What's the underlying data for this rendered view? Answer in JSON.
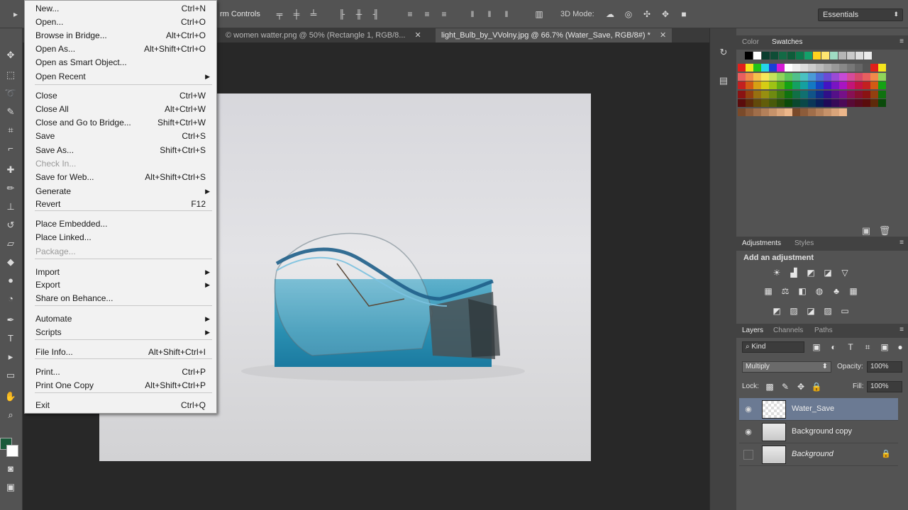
{
  "options_bar": {
    "transform_controls_label": "rm Controls",
    "mode_3d_label": "3D Mode:",
    "workspace": "Essentials"
  },
  "tabs": [
    {
      "label": "© women watter.png @ 50% (Rectangle 1, RGB/8...",
      "active": false
    },
    {
      "label": "light_Bulb_by_VVolny.jpg @ 66.7% (Water_Save, RGB/8#) *",
      "active": true
    }
  ],
  "file_menu": {
    "items": [
      {
        "label": "New...",
        "shortcut": "Ctrl+N"
      },
      {
        "label": "Open...",
        "shortcut": "Ctrl+O"
      },
      {
        "label": "Browse in Bridge...",
        "shortcut": "Alt+Ctrl+O"
      },
      {
        "label": "Open As...",
        "shortcut": "Alt+Shift+Ctrl+O"
      },
      {
        "label": "Open as Smart Object...",
        "shortcut": ""
      },
      {
        "label": "Open Recent",
        "shortcut": "",
        "submenu": true
      },
      {
        "label": "Close",
        "shortcut": "Ctrl+W"
      },
      {
        "label": "Close All",
        "shortcut": "Alt+Ctrl+W"
      },
      {
        "label": "Close and Go to Bridge...",
        "shortcut": "Shift+Ctrl+W"
      },
      {
        "label": "Save",
        "shortcut": "Ctrl+S"
      },
      {
        "label": "Save As...",
        "shortcut": "Shift+Ctrl+S"
      },
      {
        "label": "Check In...",
        "shortcut": "",
        "disabled": true
      },
      {
        "label": "Save for Web...",
        "shortcut": "Alt+Shift+Ctrl+S"
      },
      {
        "label": "Generate",
        "shortcut": "",
        "submenu": true
      },
      {
        "label": "Revert",
        "shortcut": "F12"
      },
      {
        "label": "Place Embedded...",
        "shortcut": ""
      },
      {
        "label": "Place Linked...",
        "shortcut": ""
      },
      {
        "label": "Package...",
        "shortcut": "",
        "disabled": true
      },
      {
        "label": "Import",
        "shortcut": "",
        "submenu": true
      },
      {
        "label": "Export",
        "shortcut": "",
        "submenu": true
      },
      {
        "label": "Share on Behance...",
        "shortcut": ""
      },
      {
        "label": "Automate",
        "shortcut": "",
        "submenu": true
      },
      {
        "label": "Scripts",
        "shortcut": "",
        "submenu": true
      },
      {
        "label": "File Info...",
        "shortcut": "Alt+Shift+Ctrl+I"
      },
      {
        "label": "Print...",
        "shortcut": "Ctrl+P"
      },
      {
        "label": "Print One Copy",
        "shortcut": "Alt+Shift+Ctrl+P"
      },
      {
        "label": "Exit",
        "shortcut": "Ctrl+Q"
      }
    ]
  },
  "color_panel": {
    "tabs": [
      "Color",
      "Swatches"
    ],
    "active_tab": "Swatches"
  },
  "adjustments_panel": {
    "tabs": [
      "Adjustments",
      "Styles"
    ],
    "title": "Add an adjustment"
  },
  "layers_panel": {
    "tabs": [
      "Layers",
      "Channels",
      "Paths"
    ],
    "filter_kind": "Kind",
    "blend_mode": "Multiply",
    "opacity_label": "Opacity:",
    "opacity": "100%",
    "lock_label": "Lock:",
    "fill_label": "Fill:",
    "fill": "100%",
    "layers": [
      {
        "name": "Water_Save",
        "visible": true,
        "selected": true
      },
      {
        "name": "Background copy",
        "visible": true,
        "selected": false
      },
      {
        "name": "Background",
        "visible": false,
        "selected": false,
        "locked": true
      }
    ]
  },
  "colors": {
    "foreground": "#1a5a3a",
    "background": "#ffffff",
    "selection": "#6b7a93"
  }
}
